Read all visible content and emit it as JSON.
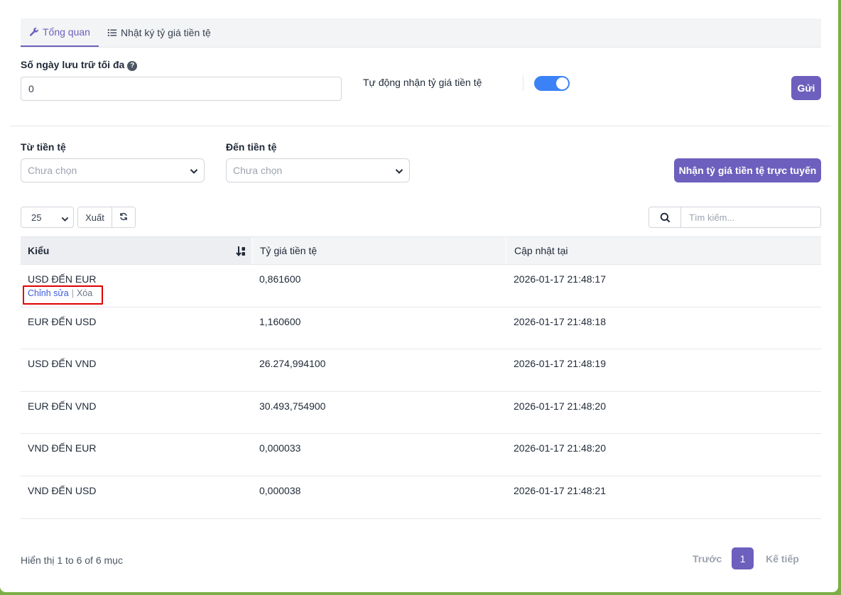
{
  "tabs": [
    {
      "label": "Tổng quan",
      "icon": "wrench-icon",
      "active": true
    },
    {
      "label": "Nhật ký tỷ giá tiền tệ",
      "icon": "list-icon",
      "active": false
    }
  ],
  "settings": {
    "retention_label": "Số ngày lưu trữ tối đa",
    "retention_value": "0",
    "auto_label": "Tự động nhận tỷ giá tiền tệ",
    "auto_enabled": true,
    "submit_label": "Gửi"
  },
  "filters": {
    "from_label": "Từ tiền tệ",
    "from_placeholder": "Chưa chọn",
    "to_label": "Đến tiền tệ",
    "to_placeholder": "Chưa chọn",
    "fetch_label": "Nhận tỷ giá tiền tệ trực tuyến"
  },
  "toolbar": {
    "page_size": "25",
    "export_label": "Xuất",
    "search_placeholder": "Tìm kiếm..."
  },
  "table": {
    "headers": [
      "Kiểu",
      "Tỷ giá tiền tệ",
      "Cập nhật tại"
    ],
    "row_actions": {
      "edit": "Chỉnh sửa",
      "delete": "Xóa"
    },
    "rows": [
      {
        "type": "USD ĐẾN EUR",
        "rate": "0,861600",
        "updated": "2026-01-17 21:48:17"
      },
      {
        "type": "EUR ĐẾN USD",
        "rate": "1,160600",
        "updated": "2026-01-17 21:48:18"
      },
      {
        "type": "USD ĐẾN VND",
        "rate": "26.274,994100",
        "updated": "2026-01-17 21:48:19"
      },
      {
        "type": "EUR ĐẾN VND",
        "rate": "30.493,754900",
        "updated": "2026-01-17 21:48:20"
      },
      {
        "type": "VND ĐẾN EUR",
        "rate": "0,000033",
        "updated": "2026-01-17 21:48:20"
      },
      {
        "type": "VND ĐẾN USD",
        "rate": "0,000038",
        "updated": "2026-01-17 21:48:21"
      }
    ]
  },
  "footer": {
    "info": "Hiển thị 1 to 6 of 6 mục",
    "prev": "Trước",
    "page": "1",
    "next": "Kế tiếp"
  },
  "colors": {
    "accent": "#6d5fbd",
    "toggle_on": "#3b82f6",
    "highlight": "#e00000"
  }
}
